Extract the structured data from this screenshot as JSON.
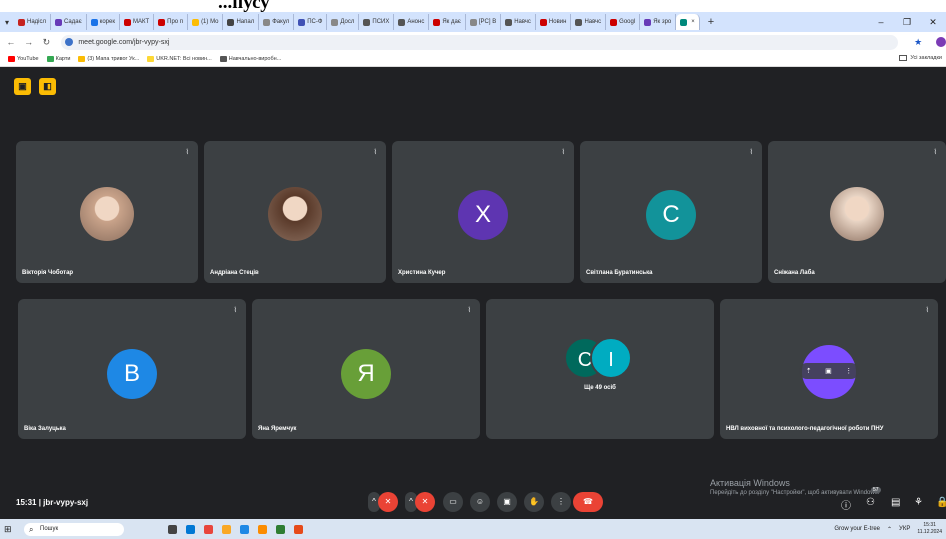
{
  "doc_heading": "...пусу",
  "browser": {
    "tabs": [
      {
        "label": "Надісл",
        "color": "#c5221f"
      },
      {
        "label": "Садає",
        "color": "#673ab7"
      },
      {
        "label": "корек",
        "color": "#1a73e8"
      },
      {
        "label": "МАКТ",
        "color": "#c00"
      },
      {
        "label": "Про п",
        "color": "#c00"
      },
      {
        "label": "(1) Мо",
        "color": "#fbbc04"
      },
      {
        "label": "Напал",
        "color": "#444"
      },
      {
        "label": "Факул",
        "color": "#888"
      },
      {
        "label": "ПС-Ф",
        "color": "#3f51b5"
      },
      {
        "label": "Досл",
        "color": "#888"
      },
      {
        "label": "ПСИХ",
        "color": "#555"
      },
      {
        "label": "Анонс",
        "color": "#555"
      },
      {
        "label": "Як дає",
        "color": "#c00"
      },
      {
        "label": "[PC] В",
        "color": "#888"
      },
      {
        "label": "Навчс",
        "color": "#555"
      },
      {
        "label": "Новин",
        "color": "#c00"
      },
      {
        "label": "Навчс",
        "color": "#555"
      },
      {
        "label": "Googl",
        "color": "#c00"
      },
      {
        "label": "Як зро",
        "color": "#673ab7"
      },
      {
        "label": "",
        "color": "#00897b",
        "active": true
      }
    ],
    "url": "meet.google.com/jbr-vypy-sxj",
    "bookmarks": [
      {
        "label": "YouTube",
        "color": "#ff0000"
      },
      {
        "label": "Карти",
        "color": "#34a853"
      },
      {
        "label": "(3) Мапа тривог Ук...",
        "color": "#fbbc04"
      },
      {
        "label": "UKR.NET: Всі новин...",
        "color": "#fdd835"
      },
      {
        "label": "Навчально-виробн...",
        "color": "#555"
      }
    ],
    "bookmarks_right": "Усі закладки"
  },
  "participants_row1": [
    {
      "name": "Вікторія Чоботар",
      "kind": "photo",
      "color": "#c9a38a"
    },
    {
      "name": "Андріана Стеців",
      "kind": "photo",
      "color": "#5a3a2a"
    },
    {
      "name": "Христина Кучер",
      "kind": "letter",
      "letter": "Х",
      "color": "#5e35b1"
    },
    {
      "name": "Світлана Буратинська",
      "kind": "letter",
      "letter": "С",
      "color": "#12939a"
    },
    {
      "name": "Сніжана Лаба",
      "kind": "photo",
      "color": "#e8d4c4"
    }
  ],
  "participants_row2": [
    {
      "name": "Віка Залуцька",
      "kind": "letter",
      "letter": "В",
      "color": "#1e88e5"
    },
    {
      "name": "Яна Яремчук",
      "kind": "letter",
      "letter": "Я",
      "color": "#689f38"
    },
    {
      "name": "",
      "kind": "group",
      "letters": [
        "С",
        "І"
      ],
      "more": "Ще 49 осіб"
    },
    {
      "name": "НВЛ виховної та психолого-педагогічної роботи ПНУ",
      "kind": "presenter",
      "color": "#7c4dff"
    }
  ],
  "meeting": {
    "time": "15:31",
    "code": "jbr-vypy-sxj",
    "participant_count": "57"
  },
  "watermark": {
    "title": "Активація Windows",
    "subtitle": "Перейдіть до розділу \"Настройки\", щоб активувати Windows."
  },
  "taskbar": {
    "search_placeholder": "Пошук",
    "weather": "Grow your E-tree",
    "lang": "УКР",
    "time": "15:31",
    "date": "11.12.2024"
  }
}
